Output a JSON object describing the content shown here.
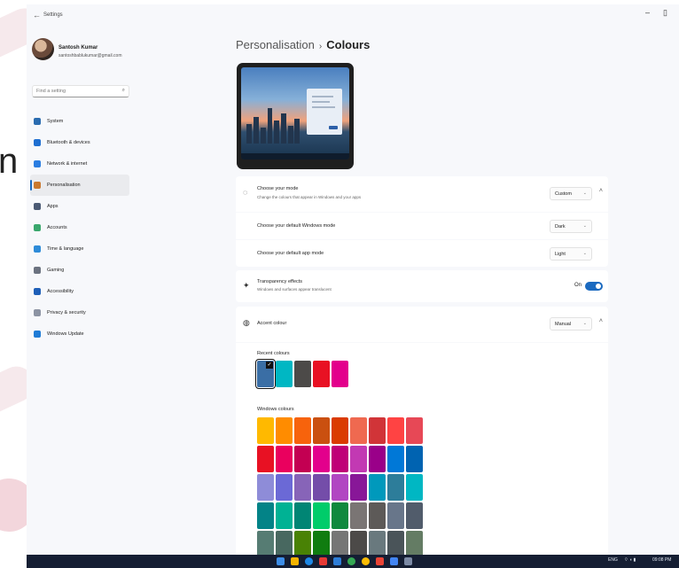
{
  "app": {
    "title": "Settings"
  },
  "window_controls": {
    "minimize": "–",
    "restore": "▯"
  },
  "background_text": "n",
  "user": {
    "name": "Santosh Kumar",
    "email": "santoshbablukumar@gmail.com"
  },
  "search": {
    "placeholder": "Find a setting"
  },
  "sidebar": {
    "items": [
      {
        "label": "System",
        "icon": "monitor-icon",
        "color": "#2b6cb0"
      },
      {
        "label": "Bluetooth & devices",
        "icon": "bluetooth-icon",
        "color": "#1f6fd1"
      },
      {
        "label": "Network & internet",
        "icon": "wifi-icon",
        "color": "#2a7de1"
      },
      {
        "label": "Personalisation",
        "icon": "brush-icon",
        "color": "#c9782e",
        "active": true
      },
      {
        "label": "Apps",
        "icon": "apps-icon",
        "color": "#4b5a74"
      },
      {
        "label": "Accounts",
        "icon": "person-icon",
        "color": "#3aa76d"
      },
      {
        "label": "Time & language",
        "icon": "globe-clock-icon",
        "color": "#2e8bd8"
      },
      {
        "label": "Gaming",
        "icon": "controller-icon",
        "color": "#6b7280"
      },
      {
        "label": "Accessibility",
        "icon": "accessibility-icon",
        "color": "#1f5fb8"
      },
      {
        "label": "Privacy & security",
        "icon": "shield-icon",
        "color": "#8c93a3"
      },
      {
        "label": "Windows Update",
        "icon": "update-icon",
        "color": "#1e7bd6"
      }
    ]
  },
  "breadcrumb": {
    "parent": "Personalisation",
    "separator": "›",
    "current": "Colours"
  },
  "mode": {
    "title": "Choose your mode",
    "subtitle": "Change the colours that appear in Windows and your apps",
    "value": "Custom",
    "windows_mode_label": "Choose your default Windows mode",
    "windows_mode_value": "Dark",
    "app_mode_label": "Choose your default app mode",
    "app_mode_value": "Light"
  },
  "transparency": {
    "title": "Transparency effects",
    "subtitle": "Windows and surfaces appear translucent",
    "state": "On"
  },
  "accent": {
    "title": "Accent colour",
    "value": "Manual"
  },
  "recent_colours": {
    "label": "Recent colours",
    "colors": [
      "#3a6ea5",
      "#00b7c3",
      "#4c4a48",
      "#e81123",
      "#e3008c"
    ]
  },
  "windows_colours": {
    "label": "Windows colours",
    "rows": [
      [
        "#ffb900",
        "#ff8c00",
        "#f7630c",
        "#ca5010",
        "#da3b01",
        "#ef6950",
        "#d13438",
        "#ff4343",
        "#e74856"
      ],
      [
        "#e81123",
        "#ea005e",
        "#c30052",
        "#e3008c",
        "#bf0077",
        "#c239b3",
        "#9a0089",
        "#0078d7",
        "#0063b1"
      ],
      [
        "#8e8cd8",
        "#6b69d6",
        "#8764b8",
        "#744da9",
        "#b146c2",
        "#881798",
        "#0099bc",
        "#2d7d9a",
        "#00b7c3"
      ],
      [
        "#038387",
        "#00b294",
        "#018574",
        "#00cc6a",
        "#10893e",
        "#7a7574",
        "#5d5a58",
        "#68768a",
        "#515c6b"
      ],
      [
        "#567c73",
        "#486860",
        "#498205",
        "#107c10",
        "#767676",
        "#4c4a48",
        "#69797e",
        "#4a5459",
        "#647c64"
      ]
    ]
  },
  "tray": {
    "language": "ENG",
    "time": "09:08 PM"
  },
  "chevron": "⌄",
  "collapse": "˄"
}
